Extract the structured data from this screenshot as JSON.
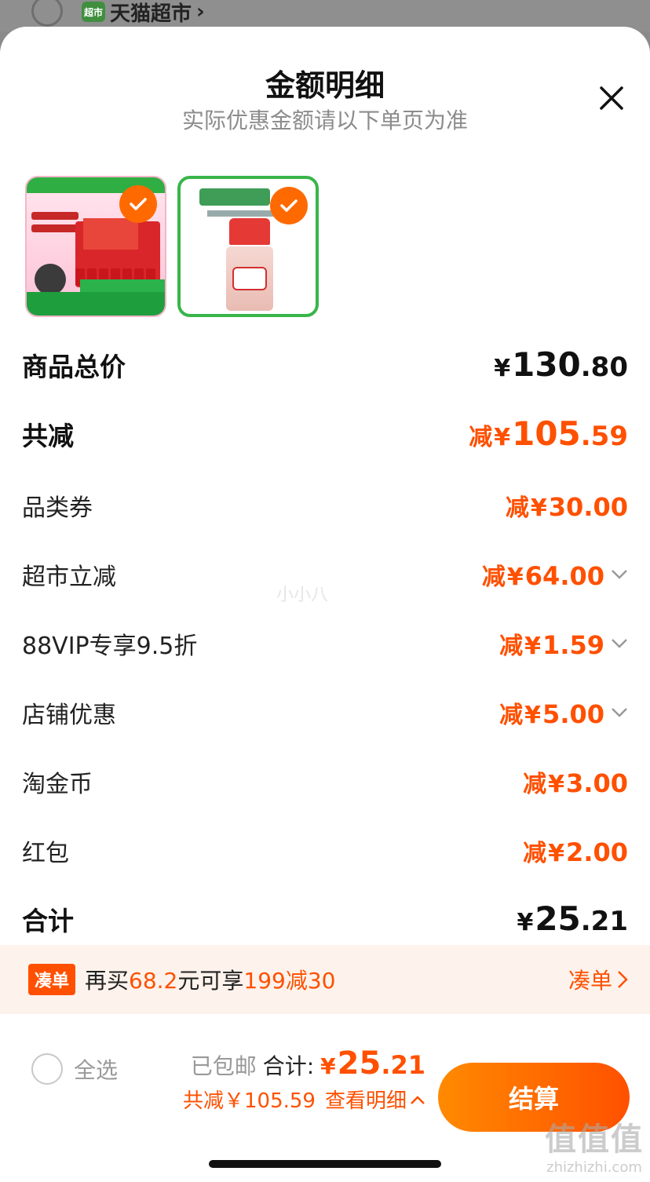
{
  "underlying": {
    "store_name": "天猫超市",
    "store_badge": "超市"
  },
  "sheet": {
    "title": "金额明细",
    "subtitle": "实际优惠金额请以下单页为准"
  },
  "rows": {
    "subtotal": {
      "label": "商品总价",
      "yen": "¥",
      "int": "130",
      "dec": ".80"
    },
    "total_discount": {
      "label": "共减",
      "prefix": "减",
      "yen": "¥",
      "int": "105",
      "dec": ".59"
    },
    "category_coupon": {
      "label": "品类券",
      "prefix": "减",
      "yen": "¥",
      "int": "30",
      "dec": ".00"
    },
    "market_instant": {
      "label": "超市立减",
      "prefix": "减",
      "yen": "¥",
      "int": "64",
      "dec": ".00"
    },
    "vip": {
      "label": "88VIP专享9.5折",
      "prefix": "减",
      "yen": "¥",
      "int": "1",
      "dec": ".59"
    },
    "shop_discount": {
      "label": "店铺优惠",
      "prefix": "减",
      "yen": "¥",
      "int": "5",
      "dec": ".00"
    },
    "taojin": {
      "label": "淘金币",
      "prefix": "减",
      "yen": "¥",
      "int": "3",
      "dec": ".00"
    },
    "red_packet": {
      "label": "红包",
      "prefix": "减",
      "yen": "¥",
      "int": "2",
      "dec": ".00"
    },
    "grand_total": {
      "label": "合计",
      "yen": "¥",
      "int": "25",
      "dec": ".21"
    }
  },
  "promo": {
    "tag": "凑单",
    "text_a": "再买",
    "text_b": "68.2",
    "text_c": "元可享",
    "text_d": "199减30",
    "link": "凑单"
  },
  "bottom": {
    "select_all": "全选",
    "shipping": "已包邮",
    "total_label": "合计:",
    "yen": "¥",
    "int": "25",
    "dec": ".21",
    "save_text": "共减￥105.59",
    "detail_link": "查看明细",
    "checkout": "结算"
  },
  "watermark": {
    "center": "小小八",
    "site_logo": "值值值",
    "site_url": "zhizhizhi.com"
  },
  "colors": {
    "accent": "#ff5000",
    "gradient_start": "#ff8a00",
    "check": "#ff6a00"
  }
}
